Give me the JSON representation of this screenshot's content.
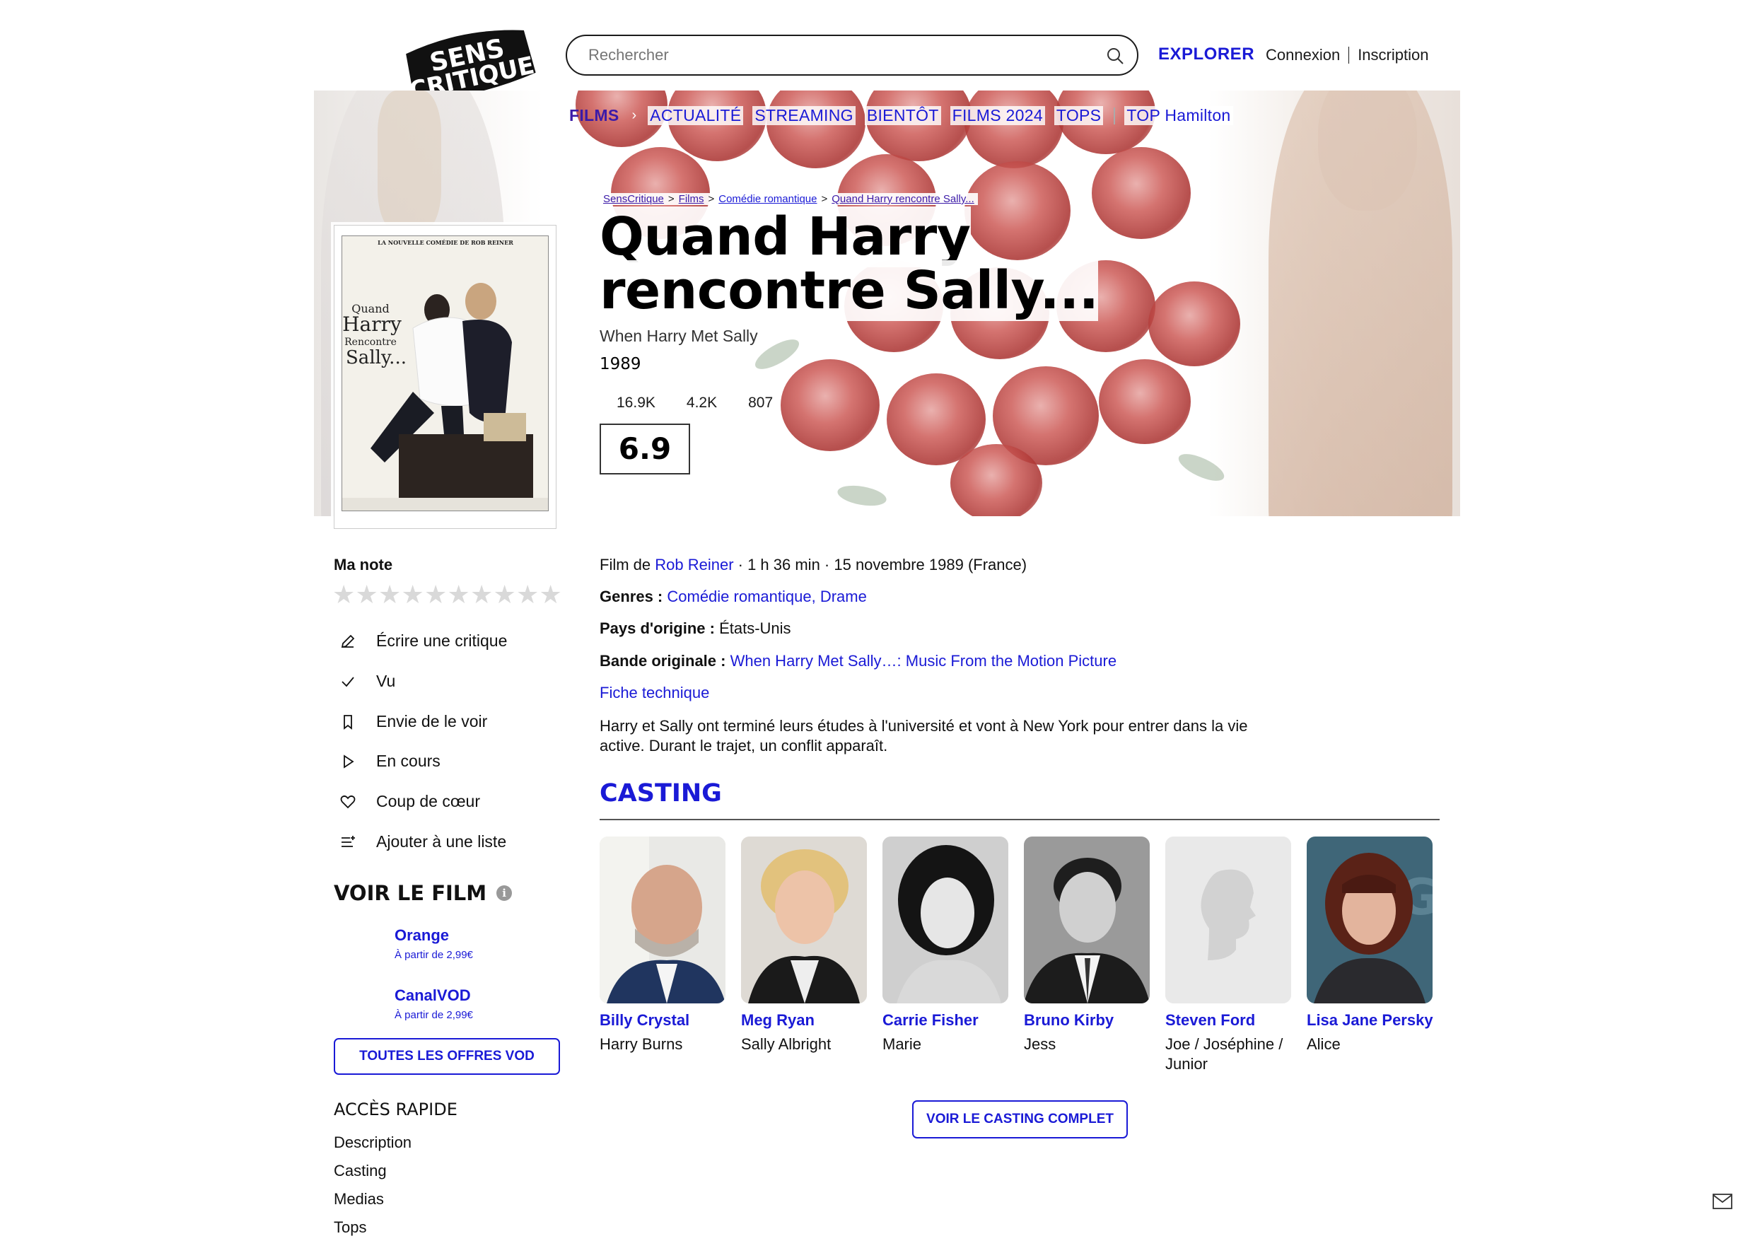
{
  "header": {
    "logo_line1": "SENS",
    "logo_line2": "CRITIQUE",
    "search_placeholder": "Rechercher",
    "explorer": "EXPLORER",
    "login": "Connexion",
    "signup": "Inscription"
  },
  "nav": {
    "films": "FILMS",
    "items": [
      "ACTUALITÉ",
      "STREAMING",
      "BIENTÔT",
      "FILMS 2024",
      "TOPS"
    ],
    "top": "TOP Hamilton"
  },
  "breadcrumb": [
    "SensCritique",
    "Films",
    "Comédie romantique",
    "Quand Harry rencontre Sally..."
  ],
  "movie": {
    "title": "Quand Harry rencontre Sally...",
    "original_title": "When Harry Met Sally",
    "year": "1989",
    "stats": [
      "16.9K",
      "4.2K",
      "807"
    ],
    "score": "6.9",
    "poster": {
      "tagline": "LA NOUVELLE COMÉDIE DE ROB REINER",
      "title_l1": "Quand",
      "title_l2": "Harry",
      "title_l3": "Rencontre",
      "title_l4": "Sally..."
    },
    "film_by_prefix": "Film de ",
    "director": "Rob Reiner",
    "meta": " · 1 h 36 min · 15 novembre 1989 (France)",
    "genres_label": "Genres : ",
    "genre_1": "Comédie romantique",
    "genre_sep": ", ",
    "genre_2": "Drame",
    "country_label": "Pays d'origine : ",
    "country": "États-Unis",
    "soundtrack_label": "Bande originale : ",
    "soundtrack": "When Harry Met Sally…: Music From the Motion Picture",
    "fiche": "Fiche technique",
    "synopsis": "Harry et Sally ont terminé leurs études à l'université et vont à New York pour entrer dans la vie active. Durant le trajet, un conflit apparaît."
  },
  "sidebar": {
    "my_rating": "Ma note",
    "stars": [
      "★",
      "★",
      "★",
      "★",
      "★",
      "★",
      "★",
      "★",
      "★",
      "★"
    ],
    "actions": [
      "Écrire une critique",
      "Vu",
      "Envie de le voir",
      "En cours",
      "Coup de cœur",
      "Ajouter à une liste"
    ],
    "watch_title": "VOIR LE FILM",
    "watch_info": "i",
    "vod": [
      {
        "name": "Orange",
        "price": "À partir de 2,99€"
      },
      {
        "name": "CanalVOD",
        "price": "À partir de 2,99€"
      }
    ],
    "all_vod": "TOUTES LES OFFRES VOD",
    "quick_title": "ACCÈS RAPIDE",
    "quick": [
      "Description",
      "Casting",
      "Medias",
      "Tops"
    ]
  },
  "casting": {
    "title": "CASTING",
    "people": [
      {
        "name": "Billy Crystal",
        "role": "Harry Burns"
      },
      {
        "name": "Meg Ryan",
        "role": "Sally Albright"
      },
      {
        "name": "Carrie Fisher",
        "role": "Marie"
      },
      {
        "name": "Bruno Kirby",
        "role": "Jess"
      },
      {
        "name": "Steven Ford",
        "role": "Joe / Joséphine / Junior"
      },
      {
        "name": "Lisa Jane Persky",
        "role": "Alice"
      }
    ],
    "full": "VOIR LE CASTING COMPLET"
  },
  "colors": {
    "accent": "#1a1ad6",
    "nav_films": "#3b1aa8",
    "rose": "#b8403c"
  }
}
